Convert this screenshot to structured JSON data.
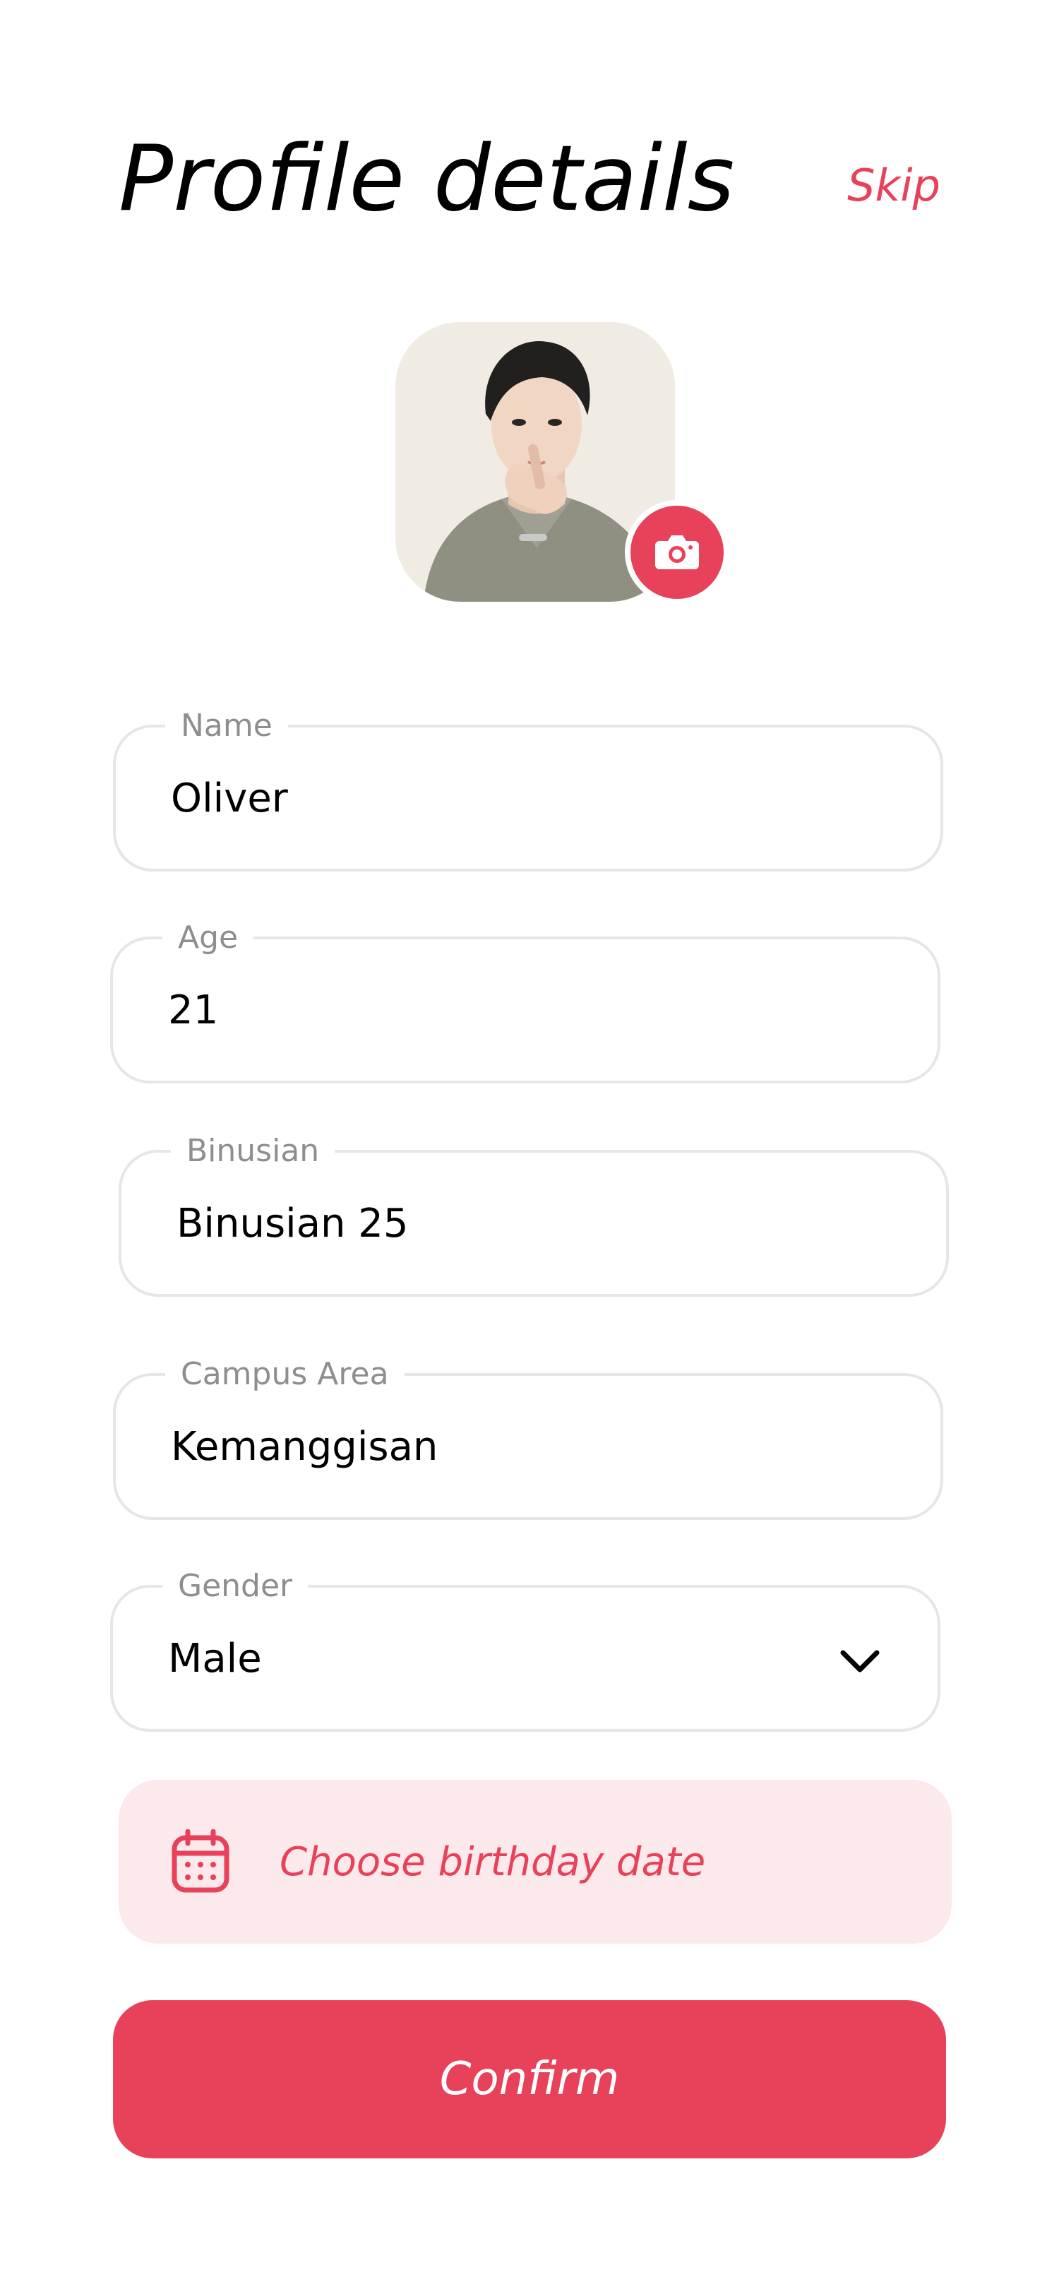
{
  "header": {
    "title": "Profile details",
    "skip_label": "Skip"
  },
  "avatar": {
    "icon": "camera-icon"
  },
  "fields": {
    "name": {
      "label": "Name",
      "value": "Oliver"
    },
    "age": {
      "label": "Age",
      "value": "21"
    },
    "binusian": {
      "label": "Binusian",
      "value": "Binusian 25"
    },
    "campus_area": {
      "label": "Campus Area",
      "value": "Kemanggisan"
    },
    "gender": {
      "label": "Gender",
      "value": "Male",
      "icon": "chevron-down-icon"
    }
  },
  "birthday": {
    "label": "Choose birthday date",
    "icon": "calendar-icon"
  },
  "confirm_label": "Confirm",
  "colors": {
    "accent": "#e8415a",
    "accent_light": "#fce9ec",
    "field_border": "#e6e6e6",
    "label_gray": "#8e8e8e"
  }
}
